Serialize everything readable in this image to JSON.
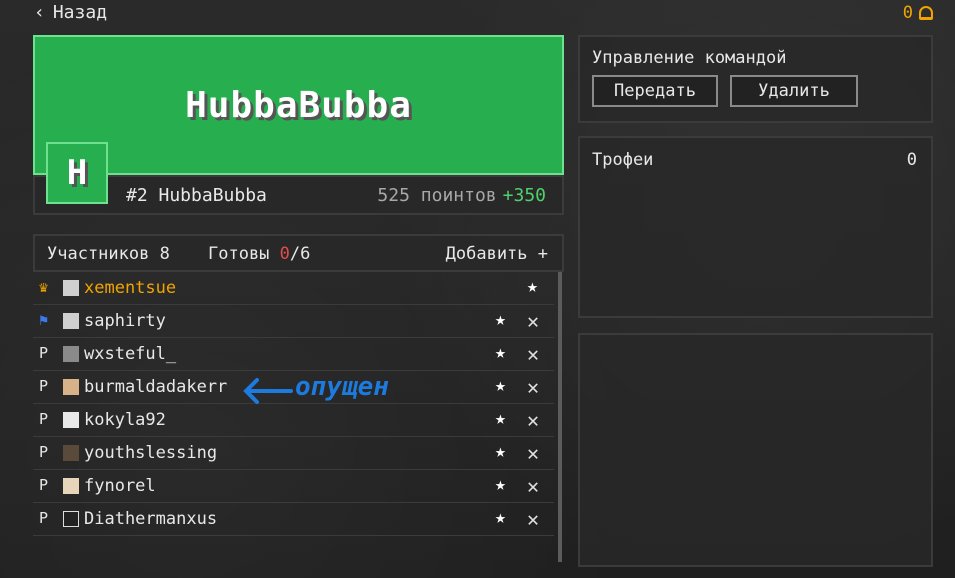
{
  "header": {
    "back_label": "Назад",
    "notifications_count": "0"
  },
  "team": {
    "name": "HubbaBubba",
    "avatar_letter": "H",
    "rank_text": "#2 HubbaBubba",
    "points_text": "525 поинтов",
    "points_delta": "+350",
    "banner_color": "#27ae4f"
  },
  "members": {
    "count_label": "Участников 8",
    "ready_label_prefix": "Готовы ",
    "ready_count": "0",
    "ready_total": "/6",
    "add_label": "Добавить +",
    "list": [
      {
        "nick": "xementsue",
        "role_icon": "crown-icon",
        "role_glyph": "♛"
      },
      {
        "nick": "saphirty",
        "role_icon": "flag-icon",
        "role_glyph": "⚑"
      },
      {
        "nick": "wxsteful_",
        "role_icon": "flag-outline-icon",
        "role_glyph": "P"
      },
      {
        "nick": "burmaldadakerr",
        "role_icon": "flag-outline-icon",
        "role_glyph": "P"
      },
      {
        "nick": "kokyla92",
        "role_icon": "flag-outline-icon",
        "role_glyph": "P"
      },
      {
        "nick": "youthslessing",
        "role_icon": "flag-outline-icon",
        "role_glyph": "P"
      },
      {
        "nick": "fynorel",
        "role_icon": "flag-outline-icon",
        "role_glyph": "P"
      },
      {
        "nick": "Diathermanxus",
        "role_icon": "flag-outline-icon",
        "role_glyph": "P"
      }
    ]
  },
  "management": {
    "title": "Управление командой",
    "transfer_label": "Передать",
    "delete_label": "Удалить"
  },
  "trophies": {
    "title": "Трофеи",
    "count": "0"
  },
  "annotation": {
    "text": "опущен"
  }
}
